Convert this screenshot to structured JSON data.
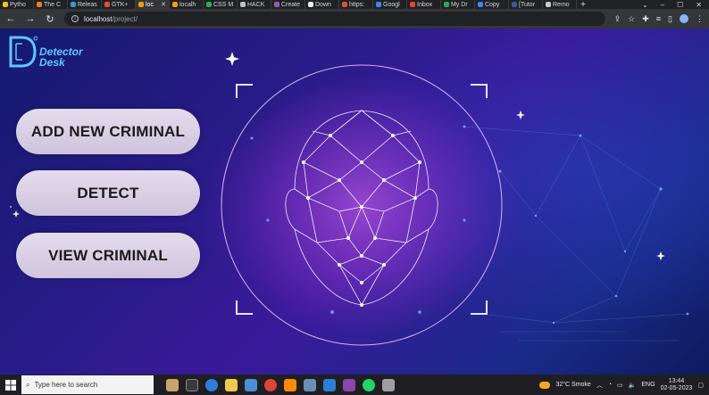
{
  "browser": {
    "tabs": [
      {
        "label": "Pytho",
        "color": "#f1c40f"
      },
      {
        "label": "The C",
        "color": "#e67e22"
      },
      {
        "label": "Releas",
        "color": "#3498db"
      },
      {
        "label": "GTK+",
        "color": "#e74c3c"
      },
      {
        "label": "loc",
        "color": "#f39c12",
        "active": true
      },
      {
        "label": "localh",
        "color": "#f39c12"
      },
      {
        "label": "CSS M",
        "color": "#27ae60"
      },
      {
        "label": "HACK",
        "color": "#bdc3c7"
      },
      {
        "label": "Create",
        "color": "#9b59b6"
      },
      {
        "label": "Down",
        "color": "#ecf0f1"
      },
      {
        "label": "https:",
        "color": "#e74c3c"
      },
      {
        "label": "Googl",
        "color": "#4285f4"
      },
      {
        "label": "Inbox",
        "color": "#ea4335"
      },
      {
        "label": "My Dr",
        "color": "#34a853"
      },
      {
        "label": "Copy",
        "color": "#4285f4"
      },
      {
        "label": "[Tutor",
        "color": "#3b5998"
      },
      {
        "label": "Remo",
        "color": "#cccccc"
      }
    ],
    "new_tab": "+",
    "url_host": "localhost",
    "url_path": "/project/"
  },
  "page": {
    "logo_line1": "Detector",
    "logo_line2": "Desk",
    "buttons": {
      "add": "ADD NEW CRIMINAL",
      "detect": "DETECT",
      "view": "VIEW CRIMINAL"
    },
    "colors": {
      "accent": "#5fc7ff",
      "button_bg": "#d8cfe4"
    }
  },
  "taskbar": {
    "search_placeholder": "Type here to search",
    "weather": "32°C  Smoke",
    "lang": "ENG",
    "time": "13:44",
    "date": "02-05-2023"
  }
}
